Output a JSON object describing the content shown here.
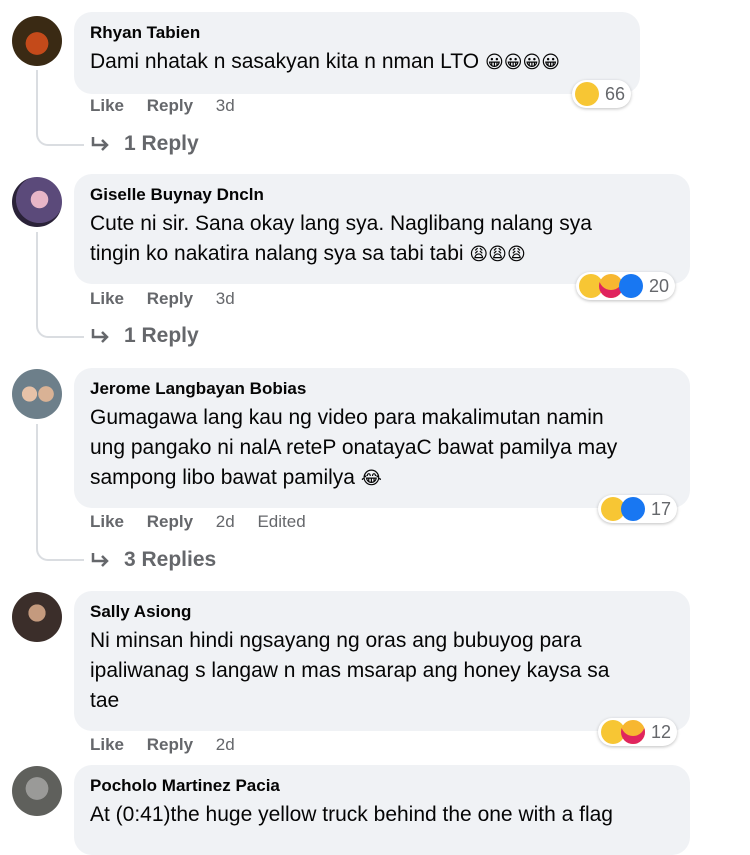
{
  "comments": [
    {
      "name": "Rhyan Tabien",
      "text_lines": [
        "Dami nhatak n sasakyan kita n nman LTO"
      ],
      "inline_emoji": "😀😀😀😀",
      "like": "Like",
      "reply": "Reply",
      "time": "3d",
      "reaction_count": "66",
      "replies": "1 Reply"
    },
    {
      "name": "Giselle Buynay Dncln",
      "text_lines": [
        "Cute ni sir. Sana okay lang sya. Naglibang nalang sya",
        "tingin ko nakatira nalang sya sa tabi tabi"
      ],
      "inline_emoji": "😩😩😩",
      "like": "Like",
      "reply": "Reply",
      "time": "3d",
      "reaction_count": "20",
      "replies": "1 Reply"
    },
    {
      "name": "Jerome Langbayan Bobias",
      "text_lines": [
        "Gumagawa lang kau ng video para makalimutan namin",
        "ung pangako ni nalA reteP onatayaC bawat pamilya may",
        "sampong libo bawat pamilya"
      ],
      "inline_emoji": "😂",
      "like": "Like",
      "reply": "Reply",
      "time": "2d",
      "edited": "Edited",
      "reaction_count": "17",
      "replies": "3 Replies"
    },
    {
      "name": "Sally Asiong",
      "text_lines": [
        "Ni minsan hindi ngsayang ng oras ang bubuyog para",
        "ipaliwanag s langaw n mas msarap ang honey kaysa sa",
        "tae"
      ],
      "like": "Like",
      "reply": "Reply",
      "time": "2d",
      "reaction_count": "12"
    },
    {
      "name": "Pocholo Martinez Pacia",
      "text_lines": [
        "At (0:41)the huge yellow truck behind the one with a flag"
      ]
    }
  ],
  "colors": {
    "bubble": "#f0f2f5",
    "meta": "#65676b",
    "like_blue": "#1877f2",
    "haha_yellow": "#f7c634"
  }
}
